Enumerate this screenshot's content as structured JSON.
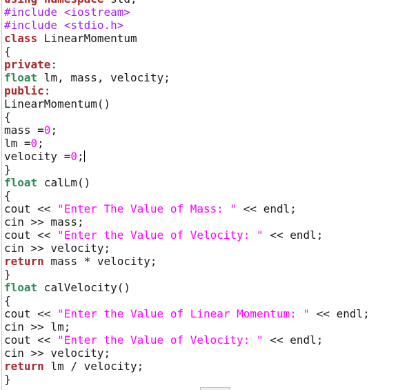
{
  "editor": {
    "lines": [
      [
        {
          "t": "kw",
          "v": "using"
        },
        {
          "t": "plain",
          "v": " "
        },
        {
          "t": "kw",
          "v": "namespace"
        },
        {
          "t": "plain",
          "v": " std;"
        }
      ],
      [
        {
          "t": "pre",
          "v": "#include <iostream>"
        }
      ],
      [
        {
          "t": "pre",
          "v": "#include <stdio.h>"
        }
      ],
      [
        {
          "t": "kw",
          "v": "class"
        },
        {
          "t": "plain",
          "v": " LinearMomentum"
        }
      ],
      [
        {
          "t": "plain",
          "v": "{"
        }
      ],
      [
        {
          "t": "kw",
          "v": "private"
        },
        {
          "t": "plain",
          "v": ":"
        }
      ],
      [
        {
          "t": "type",
          "v": "float"
        },
        {
          "t": "plain",
          "v": " lm, mass, velocity;"
        }
      ],
      [
        {
          "t": "kw",
          "v": "public"
        },
        {
          "t": "plain",
          "v": ":"
        }
      ],
      [
        {
          "t": "plain",
          "v": "LinearMomentum()"
        }
      ],
      [
        {
          "t": "plain",
          "v": "{"
        }
      ],
      [
        {
          "t": "plain",
          "v": "mass ="
        },
        {
          "t": "num",
          "v": "0"
        },
        {
          "t": "plain",
          "v": ";"
        }
      ],
      [
        {
          "t": "plain",
          "v": "lm ="
        },
        {
          "t": "num",
          "v": "0"
        },
        {
          "t": "plain",
          "v": ";"
        }
      ],
      [
        {
          "t": "plain",
          "v": "velocity ="
        },
        {
          "t": "num",
          "v": "0"
        },
        {
          "t": "plain",
          "v": ";"
        },
        {
          "t": "caret",
          "v": ""
        }
      ],
      [
        {
          "t": "plain",
          "v": "}"
        }
      ],
      [
        {
          "t": "type",
          "v": "float"
        },
        {
          "t": "plain",
          "v": " calLm()"
        }
      ],
      [
        {
          "t": "plain",
          "v": "{"
        }
      ],
      [
        {
          "t": "plain",
          "v": "cout << "
        },
        {
          "t": "str",
          "v": "\"Enter The Value of Mass: \""
        },
        {
          "t": "plain",
          "v": " << endl;"
        }
      ],
      [
        {
          "t": "plain",
          "v": "cin >> mass;"
        }
      ],
      [
        {
          "t": "plain",
          "v": "cout << "
        },
        {
          "t": "str",
          "v": "\"Enter the Value of Velocity: \""
        },
        {
          "t": "plain",
          "v": " << endl;"
        }
      ],
      [
        {
          "t": "plain",
          "v": "cin >> velocity;"
        }
      ],
      [
        {
          "t": "kw",
          "v": "return"
        },
        {
          "t": "plain",
          "v": " mass * velocity;"
        }
      ],
      [
        {
          "t": "plain",
          "v": "}"
        }
      ],
      [
        {
          "t": "type",
          "v": "float"
        },
        {
          "t": "plain",
          "v": " calVelocity()"
        }
      ],
      [
        {
          "t": "plain",
          "v": "{"
        }
      ],
      [
        {
          "t": "plain",
          "v": "cout << "
        },
        {
          "t": "str",
          "v": "\"Enter the Value of Linear Momentum: \""
        },
        {
          "t": "plain",
          "v": " << endl;"
        }
      ],
      [
        {
          "t": "plain",
          "v": "cin >> lm;"
        }
      ],
      [
        {
          "t": "plain",
          "v": "cout << "
        },
        {
          "t": "str",
          "v": "\"Enter the Value of Velocity: \""
        },
        {
          "t": "plain",
          "v": " << endl;"
        }
      ],
      [
        {
          "t": "plain",
          "v": "cin >> velocity;"
        }
      ],
      [
        {
          "t": "kw",
          "v": "return"
        },
        {
          "t": "plain",
          "v": " lm / velocity;"
        }
      ],
      [
        {
          "t": "plain",
          "v": "}"
        }
      ]
    ]
  },
  "colors": {
    "keyword": "#a52a2a",
    "type": "#2e8b57",
    "preprocessor": "#a020f0",
    "string": "#ff00ff",
    "number": "#ff00ff",
    "text": "#1a1a1a",
    "background": "#ffffff"
  }
}
